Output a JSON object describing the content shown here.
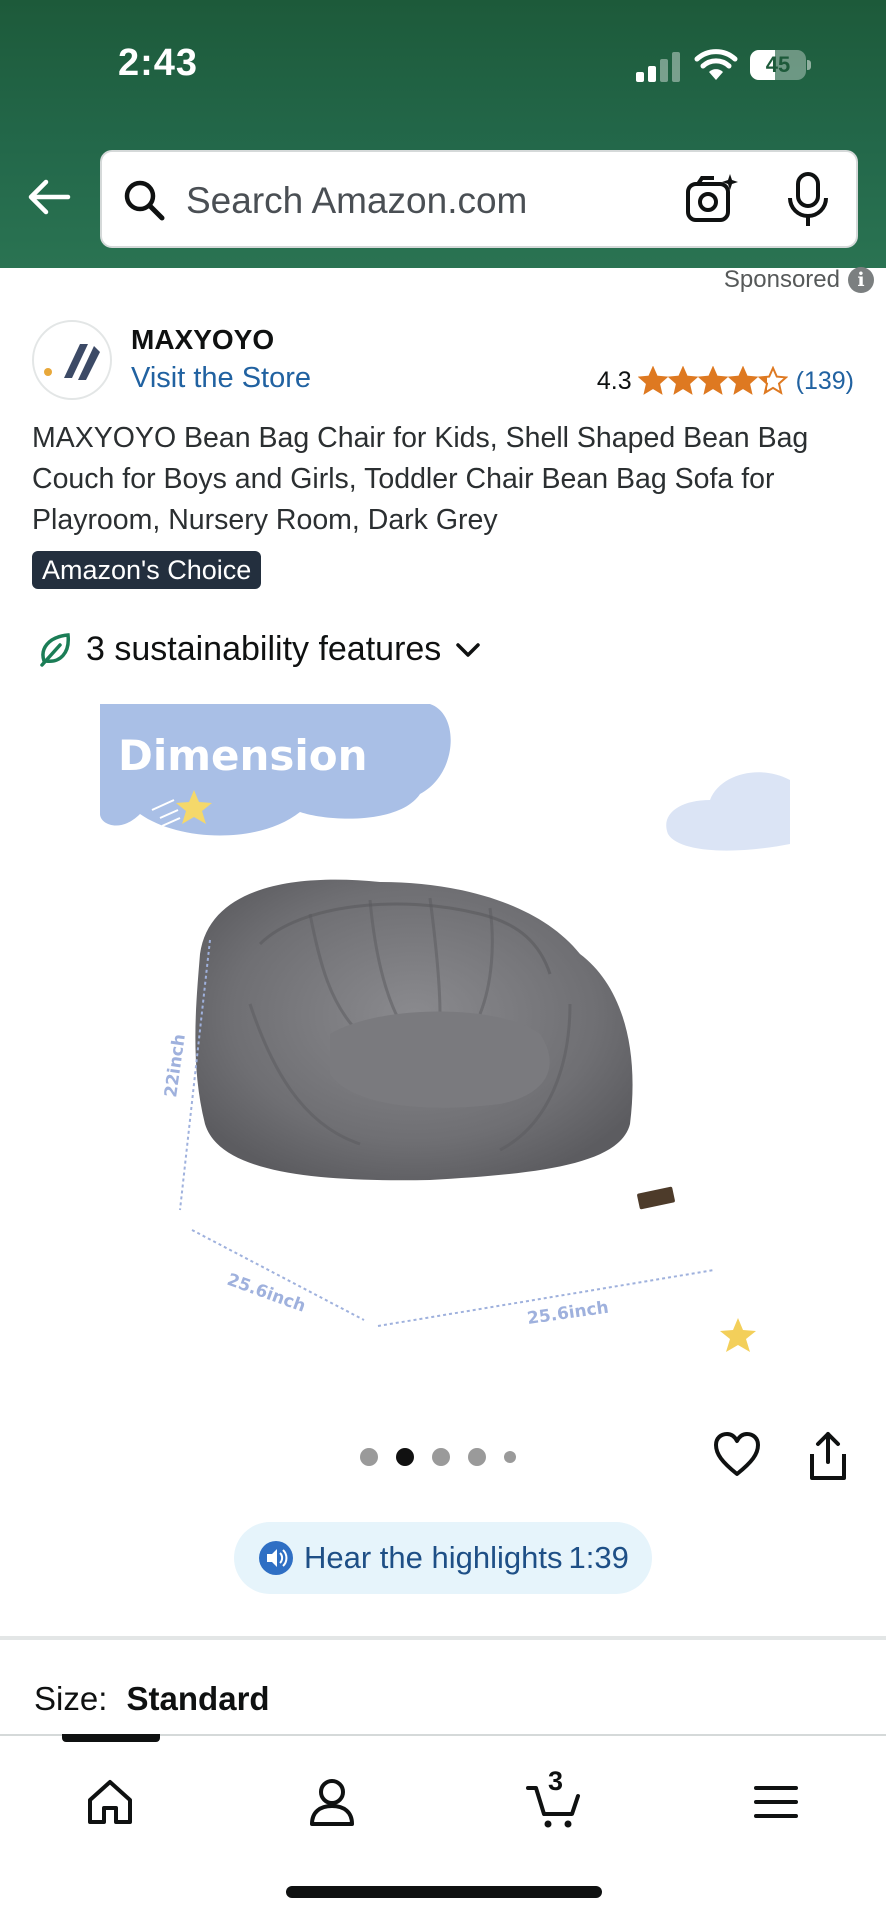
{
  "status_bar": {
    "time": "2:43",
    "battery": "45",
    "battery_level": 0.45
  },
  "search": {
    "placeholder": "Search Amazon.com"
  },
  "sponsored": "Sponsored",
  "brand": {
    "name": "MAXYOYO",
    "store_link": "Visit the Store"
  },
  "rating": {
    "value": "4.3",
    "stars": 4.3,
    "count": "(139)"
  },
  "product": {
    "title": "MAXYOYO Bean Bag Chair for Kids, Shell Shaped Bean Bag Couch for Boys and Girls, Toddler Chair Bean Bag Sofa for Playroom, Nursery Room, Dark Grey",
    "badge": "Amazon's Choice"
  },
  "sustainability": {
    "label": "3 sustainability features"
  },
  "image": {
    "heading": "Dimension",
    "height_label": "22inch",
    "depth_label": "25.6inch",
    "width_label": "25.6inch"
  },
  "carousel": {
    "count": 5,
    "active_index": 1
  },
  "highlights": {
    "label": "Hear the highlights",
    "duration": "1:39"
  },
  "size": {
    "label": "Size:",
    "value": "Standard"
  },
  "nav": {
    "cart_count": "3",
    "items": [
      "home",
      "account",
      "cart",
      "menu"
    ]
  },
  "colors": {
    "accent_green": "#1d5a3a",
    "link_blue": "#2162a1",
    "star_orange": "#de7921",
    "badge_bg": "#232f3e"
  }
}
